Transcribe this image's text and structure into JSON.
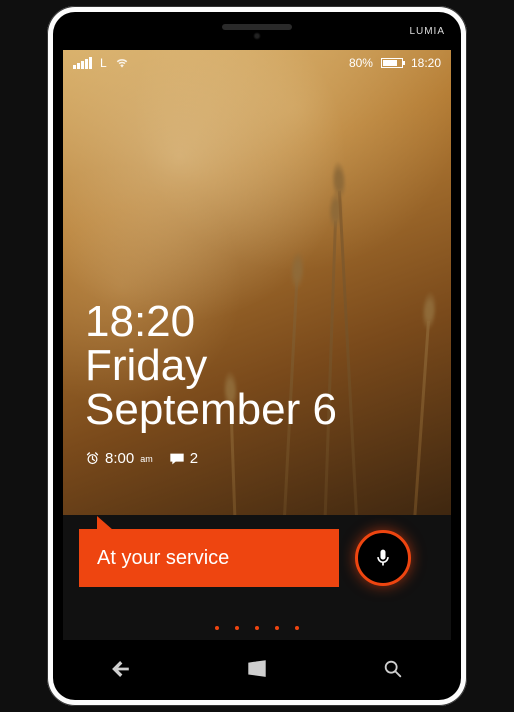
{
  "brand": "LUMIA",
  "statusbar": {
    "network_letter": "L",
    "battery_text": "80%",
    "battery_fill_pct": 80,
    "clock": "18:20"
  },
  "lockscreen": {
    "time": "18:20",
    "day": "Friday",
    "date": "September 6",
    "alarm_time": "8:00",
    "alarm_ampm": "am",
    "msg_count": "2"
  },
  "assistant": {
    "speech": "At your service"
  }
}
